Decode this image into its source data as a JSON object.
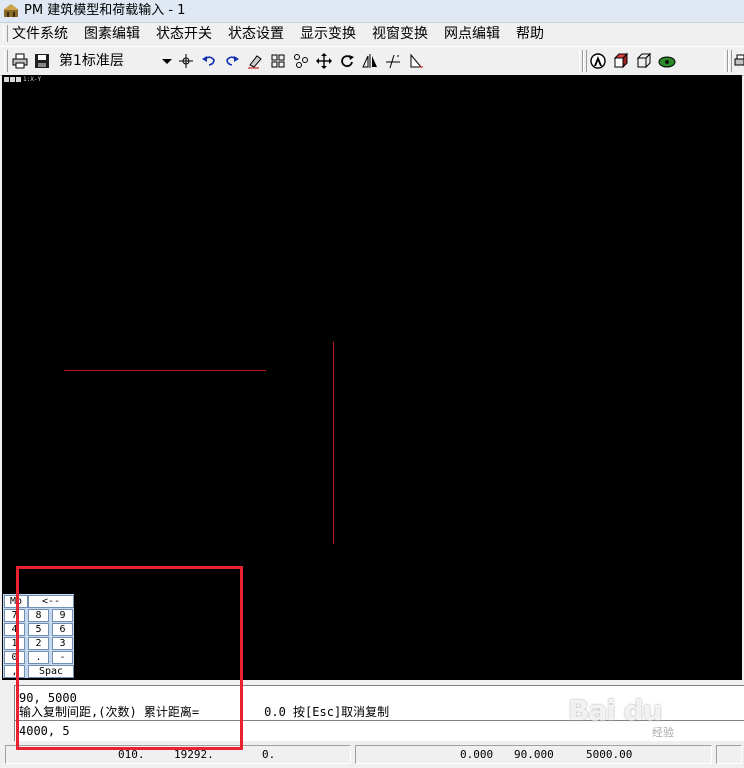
{
  "window": {
    "title": "PM 建筑模型和荷载输入 - 1"
  },
  "menu": [
    "文件系统",
    "图素编辑",
    "状态开关",
    "状态设置",
    "显示变换",
    "视窗变换",
    "网点编辑",
    "帮助"
  ],
  "toolbar": {
    "layer_value": "第1标准层",
    "icons": [
      "print-icon",
      "save-icon",
      "axis-node-icon",
      "undo-icon",
      "redo-icon",
      "erase-icon",
      "grid-icon",
      "snap-icon",
      "pan-icon",
      "rotate-icon",
      "mirror-icon",
      "dimension-icon",
      "triangle-icon",
      "render-icon",
      "3d-box-icon",
      "wireframe-box-icon",
      "view-icon"
    ]
  },
  "canvas": {
    "corner_label": "1:X-Y",
    "background": "#000000",
    "line_color": "#c41414"
  },
  "keypad": {
    "keys": [
      "Mo",
      "<--",
      "7",
      "8",
      "9",
      "4",
      "5",
      "6",
      "1",
      "2",
      "3",
      "0",
      ".",
      "-",
      ",",
      "Spac"
    ]
  },
  "command": {
    "history_1": "90, 5000",
    "prompt": "输入复制间距,(次数) 累计距离=         0.0 按[Esc]取消复制",
    "input": "4000, 5"
  },
  "status": {
    "cell_1": "010.",
    "cell_2": "19292.",
    "cell_3": "0.",
    "cell_4a": "0.000",
    "cell_4b": "90.000",
    "cell_4c": "5000.00"
  },
  "watermark": {
    "text": "Bai du",
    "sub": "经验"
  },
  "annotation": {
    "highlight_color": "#e8232f"
  }
}
